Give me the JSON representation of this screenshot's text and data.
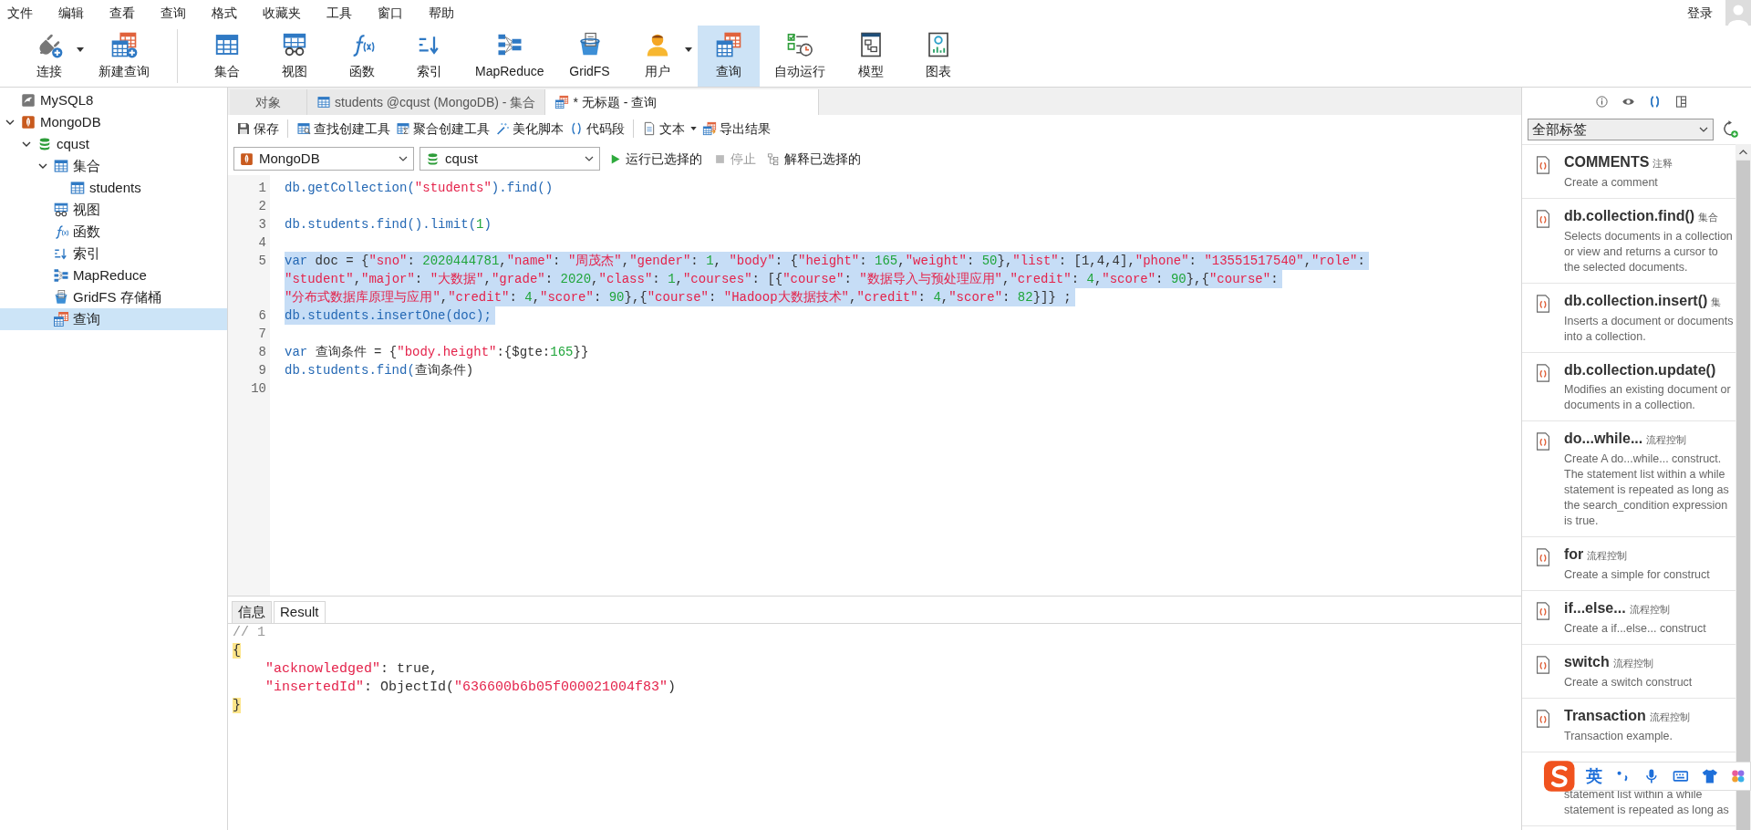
{
  "menu": [
    "文件",
    "编辑",
    "查看",
    "查询",
    "格式",
    "收藏夹",
    "工具",
    "窗口",
    "帮助"
  ],
  "account": {
    "login": "登录"
  },
  "toolbar": {
    "groups": [
      [
        {
          "label": "连接",
          "kind": "plug",
          "dropdown": true,
          "selected": false
        },
        {
          "label": "新建查询",
          "kind": "new-query",
          "dropdown": false,
          "selected": false
        }
      ],
      [
        {
          "label": "集合",
          "kind": "table",
          "dropdown": false,
          "selected": false
        },
        {
          "label": "视图",
          "kind": "view",
          "dropdown": false,
          "selected": false
        },
        {
          "label": "函数",
          "kind": "function",
          "dropdown": false,
          "selected": false
        },
        {
          "label": "索引",
          "kind": "index",
          "dropdown": false,
          "selected": false
        },
        {
          "label": "MapReduce",
          "kind": "mapreduce",
          "dropdown": false,
          "selected": false
        },
        {
          "label": "GridFS",
          "kind": "gridfs",
          "dropdown": false,
          "selected": false
        },
        {
          "label": "用户",
          "kind": "user",
          "dropdown": true,
          "selected": false
        },
        {
          "label": "查询",
          "kind": "query",
          "dropdown": false,
          "selected": true
        },
        {
          "label": "自动运行",
          "kind": "automation",
          "dropdown": false,
          "selected": false
        },
        {
          "label": "模型",
          "kind": "model",
          "dropdown": false,
          "selected": false
        },
        {
          "label": "图表",
          "kind": "chart",
          "dropdown": false,
          "selected": false
        }
      ]
    ]
  },
  "sidebar": {
    "tree": [
      {
        "label": "MySQL8",
        "kind": "mysql",
        "selected": false
      },
      {
        "label": "MongoDB",
        "kind": "mongo",
        "expanded": true,
        "selected": false,
        "children": [
          {
            "label": "cqust",
            "kind": "db",
            "expanded": true,
            "selected": false,
            "children": [
              {
                "label": "集合",
                "kind": "table",
                "expanded": true,
                "selected": false,
                "children": [
                  {
                    "label": "students",
                    "kind": "table",
                    "selected": false
                  }
                ]
              },
              {
                "label": "视图",
                "kind": "view",
                "selected": false
              },
              {
                "label": "函数",
                "kind": "function",
                "selected": false
              },
              {
                "label": "索引",
                "kind": "index",
                "selected": false
              },
              {
                "label": "MapReduce",
                "kind": "mapreduce",
                "selected": false
              },
              {
                "label": "GridFS 存储桶",
                "kind": "gridfs",
                "selected": false
              },
              {
                "label": "查询",
                "kind": "query",
                "selected": true
              }
            ]
          }
        ]
      }
    ]
  },
  "editor_tabs": [
    {
      "label": "对象",
      "kind": "plain",
      "selected": false
    },
    {
      "label": "students @cqust (MongoDB) - 集合",
      "kind": "table",
      "selected": false
    },
    {
      "label": "* 无标题 - 查询",
      "kind": "query",
      "selected": true
    }
  ],
  "editor_toolbar": {
    "groups": [
      [
        {
          "label": "保存",
          "kind": "save",
          "dropdown": false
        }
      ],
      [
        {
          "label": "查找创建工具",
          "kind": "find-builder",
          "dropdown": false
        },
        {
          "label": "聚合创建工具",
          "kind": "aggregate-builder",
          "dropdown": false
        },
        {
          "label": "美化脚本",
          "kind": "beautify",
          "dropdown": false
        },
        {
          "label": "代码段",
          "kind": "snippet",
          "dropdown": false
        }
      ],
      [
        {
          "label": "文本",
          "kind": "text",
          "dropdown": true
        },
        {
          "label": "导出结果",
          "kind": "export",
          "dropdown": false
        }
      ]
    ]
  },
  "run_bar": {
    "connection": {
      "value": "MongoDB"
    },
    "database": {
      "value": "cqust"
    },
    "actions": [
      {
        "label": "运行已选择的",
        "kind": "run",
        "disabled": false
      },
      {
        "label": "停止",
        "kind": "stop",
        "disabled": true
      },
      {
        "label": "解释已选择的",
        "kind": "explain",
        "disabled": false
      }
    ]
  },
  "editor": {
    "lines": [
      {
        "number": "1",
        "selected": false,
        "rows": [
          {
            "tokens": [
              {
                "kind": "kw",
                "text": "db.getCollection("
              },
              {
                "kind": "str",
                "text": "\"students\""
              },
              {
                "kind": "kw",
                "text": ").find()"
              }
            ]
          }
        ]
      },
      {
        "number": "2",
        "selected": false
      },
      {
        "number": "3",
        "selected": false,
        "rows": [
          {
            "tokens": [
              {
                "kind": "kw",
                "text": "db.students.find().limit("
              },
              {
                "kind": "num",
                "text": "1"
              },
              {
                "kind": "kw",
                "text": ")"
              }
            ]
          }
        ]
      },
      {
        "number": "4",
        "selected": false
      },
      {
        "number": "5",
        "selected": true,
        "rows": [
          {
            "tokens": [
              {
                "kind": "kw",
                "text": "var"
              },
              {
                "kind": "plain",
                "text": " doc = {"
              },
              {
                "kind": "str",
                "text": "\"sno\""
              },
              {
                "kind": "plain",
                "text": ": "
              },
              {
                "kind": "num",
                "text": "2020444781"
              },
              {
                "kind": "plain",
                "text": ","
              },
              {
                "kind": "str",
                "text": "\"name\""
              },
              {
                "kind": "plain",
                "text": ": "
              },
              {
                "kind": "str",
                "text": "\"周茂杰\""
              },
              {
                "kind": "plain",
                "text": ","
              },
              {
                "kind": "str",
                "text": "\"gender\""
              },
              {
                "kind": "plain",
                "text": ": "
              },
              {
                "kind": "num",
                "text": "1"
              },
              {
                "kind": "plain",
                "text": ", "
              },
              {
                "kind": "str",
                "text": "\"body\""
              },
              {
                "kind": "plain",
                "text": ": {"
              },
              {
                "kind": "str",
                "text": "\"height\""
              },
              {
                "kind": "plain",
                "text": ": "
              },
              {
                "kind": "num",
                "text": "165"
              },
              {
                "kind": "plain",
                "text": ","
              },
              {
                "kind": "str",
                "text": "\"weight\""
              },
              {
                "kind": "plain",
                "text": ": "
              },
              {
                "kind": "num",
                "text": "50"
              },
              {
                "kind": "plain",
                "text": "},"
              },
              {
                "kind": "str",
                "text": "\"list\""
              },
              {
                "kind": "plain",
                "text": ": [1,4,4],"
              },
              {
                "kind": "str",
                "text": "\"phone\""
              },
              {
                "kind": "plain",
                "text": ": "
              },
              {
                "kind": "str",
                "text": "\"13551517540\""
              },
              {
                "kind": "plain",
                "text": ","
              },
              {
                "kind": "str",
                "text": "\"role\""
              },
              {
                "kind": "plain",
                "text": ":"
              }
            ]
          },
          {
            "tokens": [
              {
                "kind": "str",
                "text": "\"student\""
              },
              {
                "kind": "plain",
                "text": ","
              },
              {
                "kind": "str",
                "text": "\"major\""
              },
              {
                "kind": "plain",
                "text": ": "
              },
              {
                "kind": "str",
                "text": "\"大数据\""
              },
              {
                "kind": "plain",
                "text": ","
              },
              {
                "kind": "str",
                "text": "\"grade\""
              },
              {
                "kind": "plain",
                "text": ": "
              },
              {
                "kind": "num",
                "text": "2020"
              },
              {
                "kind": "plain",
                "text": ","
              },
              {
                "kind": "str",
                "text": "\"class\""
              },
              {
                "kind": "plain",
                "text": ": "
              },
              {
                "kind": "num",
                "text": "1"
              },
              {
                "kind": "plain",
                "text": ","
              },
              {
                "kind": "str",
                "text": "\"courses\""
              },
              {
                "kind": "plain",
                "text": ": [{"
              },
              {
                "kind": "str",
                "text": "\"course\""
              },
              {
                "kind": "plain",
                "text": ": "
              },
              {
                "kind": "str",
                "text": "\"数据导入与预处理应用\""
              },
              {
                "kind": "plain",
                "text": ","
              },
              {
                "kind": "str",
                "text": "\"credit\""
              },
              {
                "kind": "plain",
                "text": ": "
              },
              {
                "kind": "num",
                "text": "4"
              },
              {
                "kind": "plain",
                "text": ","
              },
              {
                "kind": "str",
                "text": "\"score\""
              },
              {
                "kind": "plain",
                "text": ": "
              },
              {
                "kind": "num",
                "text": "90"
              },
              {
                "kind": "plain",
                "text": "},{"
              },
              {
                "kind": "str",
                "text": "\"course\""
              },
              {
                "kind": "plain",
                "text": ":"
              }
            ]
          },
          {
            "tokens": [
              {
                "kind": "str",
                "text": "\"分布式数据库原理与应用\""
              },
              {
                "kind": "plain",
                "text": ","
              },
              {
                "kind": "str",
                "text": "\"credit\""
              },
              {
                "kind": "plain",
                "text": ": "
              },
              {
                "kind": "num",
                "text": "4"
              },
              {
                "kind": "plain",
                "text": ","
              },
              {
                "kind": "str",
                "text": "\"score\""
              },
              {
                "kind": "plain",
                "text": ": "
              },
              {
                "kind": "num",
                "text": "90"
              },
              {
                "kind": "plain",
                "text": "},{"
              },
              {
                "kind": "str",
                "text": "\"course\""
              },
              {
                "kind": "plain",
                "text": ": "
              },
              {
                "kind": "str",
                "text": "\"Hadoop大数据技术\""
              },
              {
                "kind": "plain",
                "text": ","
              },
              {
                "kind": "str",
                "text": "\"credit\""
              },
              {
                "kind": "plain",
                "text": ": "
              },
              {
                "kind": "num",
                "text": "4"
              },
              {
                "kind": "plain",
                "text": ","
              },
              {
                "kind": "str",
                "text": "\"score\""
              },
              {
                "kind": "plain",
                "text": ": "
              },
              {
                "kind": "num",
                "text": "82"
              },
              {
                "kind": "plain",
                "text": "}]} ;"
              }
            ]
          }
        ]
      },
      {
        "number": "6",
        "selected": true,
        "rows": [
          {
            "tokens": [
              {
                "kind": "kw",
                "text": "db.students.insertOne(doc);"
              }
            ]
          }
        ]
      },
      {
        "number": "7",
        "selected": false
      },
      {
        "number": "8",
        "selected": false,
        "rows": [
          {
            "tokens": [
              {
                "kind": "kw",
                "text": "var"
              },
              {
                "kind": "plain",
                "text": " 查询条件 = {"
              },
              {
                "kind": "str",
                "text": "\"body.height\""
              },
              {
                "kind": "plain",
                "text": ":{$gte:"
              },
              {
                "kind": "num",
                "text": "165"
              },
              {
                "kind": "plain",
                "text": "}}"
              }
            ]
          }
        ]
      },
      {
        "number": "9",
        "selected": false,
        "rows": [
          {
            "tokens": [
              {
                "kind": "kw",
                "text": "db.students.find("
              },
              {
                "kind": "plain",
                "text": "查询条件)"
              }
            ]
          }
        ]
      },
      {
        "number": "10",
        "selected": false
      }
    ]
  },
  "result_tabs": [
    {
      "label": "信息",
      "selected": false
    },
    {
      "label": "Result",
      "selected": true
    }
  ],
  "result": {
    "lines": [
      {
        "indent": false,
        "tokens": [
          {
            "kind": "comment",
            "text": "// 1"
          }
        ]
      },
      {
        "indent": false,
        "tokens": [
          {
            "kind": "brace",
            "text": "{"
          }
        ]
      },
      {
        "indent": true,
        "tokens": [
          {
            "kind": "str",
            "text": "\"acknowledged\""
          },
          {
            "kind": "plain",
            "text": ": true,"
          }
        ]
      },
      {
        "indent": true,
        "tokens": [
          {
            "kind": "str",
            "text": "\"insertedId\""
          },
          {
            "kind": "plain",
            "text": ": ObjectId("
          },
          {
            "kind": "str",
            "text": "\"636600b6b05f000021004f83\""
          },
          {
            "kind": "plain",
            "text": ")"
          }
        ]
      },
      {
        "indent": false,
        "tokens": [
          {
            "kind": "brace",
            "text": "}"
          }
        ]
      }
    ]
  },
  "snippet_panel": {
    "icons": [
      {
        "kind": "info",
        "selected": false
      },
      {
        "kind": "preview",
        "selected": false
      },
      {
        "kind": "code",
        "selected": true
      },
      {
        "kind": "layout",
        "selected": false
      }
    ],
    "filter": {
      "value": "全部标签"
    },
    "items": [
      {
        "title": "COMMENTS",
        "tag": "注释",
        "description": "Create a comment"
      },
      {
        "title": "db.collection.find()",
        "tag": "集合",
        "description": "Selects documents in a collection or view and returns a cursor to the selected documents."
      },
      {
        "title": "db.collection.insert()",
        "tag": "集",
        "description": "Inserts a document or documents into a collection."
      },
      {
        "title": "db.collection.update()",
        "description": "Modifies an existing document or documents in a collection."
      },
      {
        "title": "do...while...",
        "tag": "流程控制",
        "description": "Create A do...while... construct. The statement list within a while statement is repeated as long as the search_condition expression is true."
      },
      {
        "title": "for",
        "tag": "流程控制",
        "description": "Create a simple for construct"
      },
      {
        "title": "if...else...",
        "tag": "流程控制",
        "description": "Create a if...else... construct"
      },
      {
        "title": "switch",
        "tag": "流程控制",
        "description": "Create a switch construct"
      },
      {
        "title": "Transaction",
        "tag": "流程控制",
        "description": "Transaction example."
      },
      {
        "description": "statement list within a while statement is repeated as long as"
      }
    ]
  },
  "ime_bar": {
    "mode": "英"
  }
}
